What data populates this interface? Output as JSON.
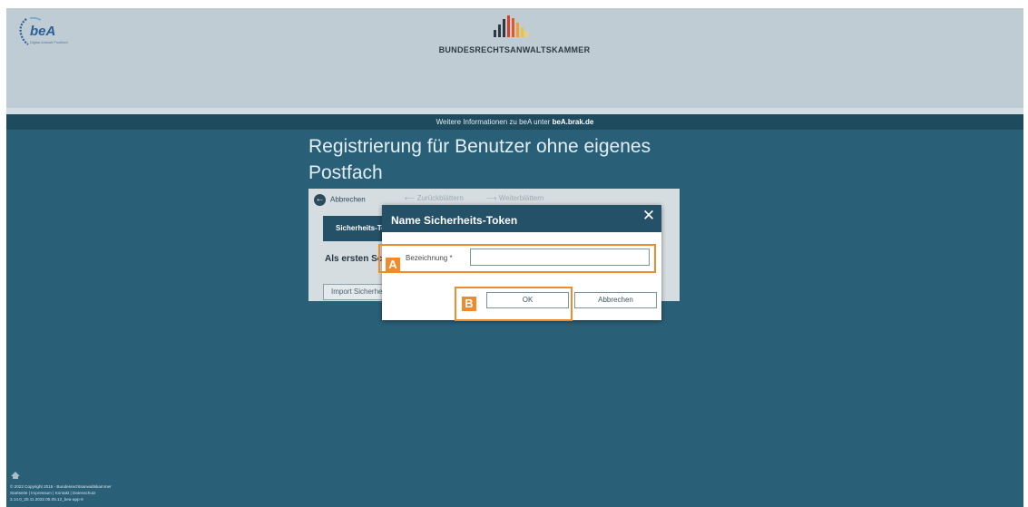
{
  "header": {
    "bea_logo_text": "beA",
    "bea_logo_tagline": "Digital Antwalt Postfach",
    "brak_title": "BUNDESRECHTSANWALTSKAMMER"
  },
  "info_bar": {
    "text": "Weitere Informationen zu beA unter ",
    "link": "beA.brak.de"
  },
  "page": {
    "title": "Registrierung für Benutzer ohne eigenes Postfach"
  },
  "panel": {
    "toolbar": {
      "cancel_label": "Abbrechen",
      "back_label": "Zurückblättern",
      "forward_label": "Weiterblättern"
    },
    "tab_label": "Sicherheits-Token",
    "subtitle": "Als ersten Schritt",
    "import_button": "Import Sicherheits-Token"
  },
  "dialog": {
    "title": "Name Sicherheits-Token",
    "close_symbol": "✕",
    "field_label": "Bezeichnung *",
    "field_value": "",
    "ok_button": "OK",
    "cancel_button": "Abbrechen"
  },
  "annotations": {
    "marker_a": "A",
    "marker_b": "B",
    "highlight_color": "#f08a2c"
  },
  "footer": {
    "copyright": "© 2022 Copyright 2015 - Bundesrechtsanwaltskammer",
    "links": "Startseite | Impressum | Kontakt | Datenschutz",
    "version": "3.14.0_20.11.2022.05.05.12_bea-app-8"
  },
  "colors": {
    "page_background": "#2a5f78",
    "header_background": "#bfccd3",
    "dialog_header": "#245068",
    "accent": "#f08a2c"
  },
  "icons": {
    "bea_logo": "bea-wave-logo",
    "brak_logo": "brak-bar-logo",
    "back_arrow": "arrow-left-circle-icon",
    "close": "close-icon"
  }
}
